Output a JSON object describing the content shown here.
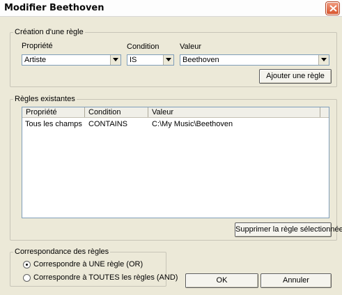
{
  "window": {
    "title": "Modifier Beethoven"
  },
  "creation": {
    "legend": "Création d'une règle",
    "property_label": "Propriété",
    "property_value": "Artiste",
    "condition_label": "Condition",
    "condition_value": "IS",
    "value_label": "Valeur",
    "value_value": "Beethoven",
    "add_button": "Ajouter une règle"
  },
  "existing": {
    "legend": "Règles existantes",
    "columns": [
      "Propriété",
      "Condition",
      "Valeur"
    ],
    "rows": [
      {
        "property": "Tous les champs",
        "condition": "CONTAINS",
        "value": "C:\\My Music\\Beethoven"
      }
    ],
    "delete_button": "Supprimer la règle sélectionnée"
  },
  "matching": {
    "legend": "Correspondance des règles",
    "options": [
      {
        "label": "Correspondre à UNE règle (OR)",
        "selected": true
      },
      {
        "label": "Correspondre à TOUTES les règles (AND)",
        "selected": false
      }
    ]
  },
  "buttons": {
    "ok": "OK",
    "cancel": "Annuler"
  },
  "icons": {
    "close": "close-icon",
    "dropdown": "chevron-down-icon"
  },
  "colors": {
    "close_button": "#d8562f",
    "field_border": "#7f9db9",
    "dialog_bg": "#ece9d8"
  }
}
